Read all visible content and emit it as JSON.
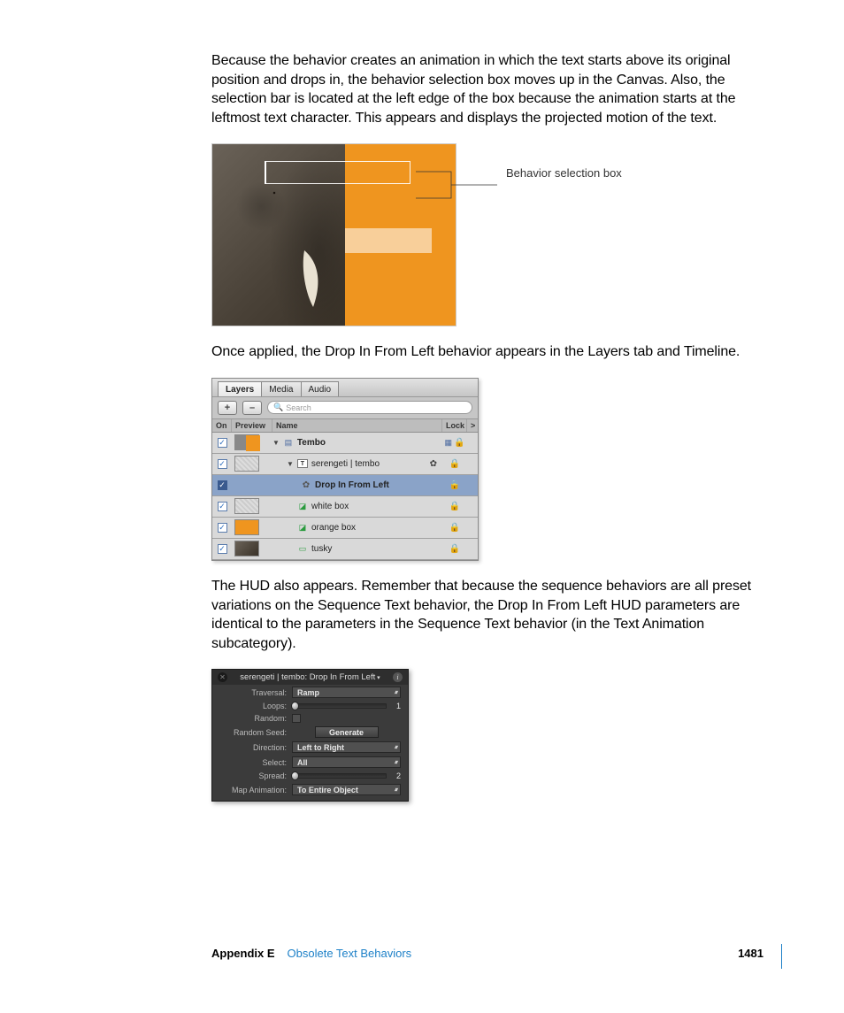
{
  "para1": "Because the behavior creates an animation in which the text starts above its original position and drops in, the behavior selection box moves up in the Canvas. Also, the selection bar is located at the left edge of the box because the animation starts at the leftmost text character. This appears and displays the projected motion of the text.",
  "callout1": "Behavior selection box",
  "para2": "Once applied, the Drop In From Left behavior appears in the Layers tab and Timeline.",
  "para3": "The HUD also appears. Remember that because the sequence behaviors are all preset variations on the Sequence Text behavior, the Drop In From Left HUD parameters are identical to the parameters in the Sequence Text behavior (in the Text Animation subcategory).",
  "layers": {
    "tabs": [
      "Layers",
      "Media",
      "Audio"
    ],
    "add": "+",
    "remove": "–",
    "search_placeholder": "Search",
    "headers": {
      "on": "On",
      "preview": "Preview",
      "name": "Name",
      "lock": "Lock"
    },
    "rows": [
      {
        "name": "Tembo",
        "indent": 0,
        "kind": "group",
        "bold": true
      },
      {
        "name": "serengeti | tembo",
        "indent": 1,
        "kind": "text",
        "gear": true
      },
      {
        "name": "Drop In From Left",
        "indent": 2,
        "kind": "behavior",
        "selected": true
      },
      {
        "name": "white box",
        "indent": 1,
        "kind": "shape"
      },
      {
        "name": "orange box",
        "indent": 1,
        "kind": "shape"
      },
      {
        "name": "tusky",
        "indent": 1,
        "kind": "image"
      }
    ]
  },
  "hud": {
    "title": "serengeti | tembo: Drop In From Left",
    "rows": {
      "traversal_label": "Traversal:",
      "traversal": "Ramp",
      "loops_label": "Loops:",
      "loops": "1",
      "random_label": "Random:",
      "seed_label": "Random Seed:",
      "seed_button": "Generate",
      "direction_label": "Direction:",
      "direction": "Left to Right",
      "select_label": "Select:",
      "select": "All",
      "spread_label": "Spread:",
      "spread": "2",
      "map_label": "Map Animation:",
      "map": "To Entire Object"
    }
  },
  "footer": {
    "appendix": "Appendix E",
    "title": "Obsolete Text Behaviors",
    "page": "1481"
  }
}
